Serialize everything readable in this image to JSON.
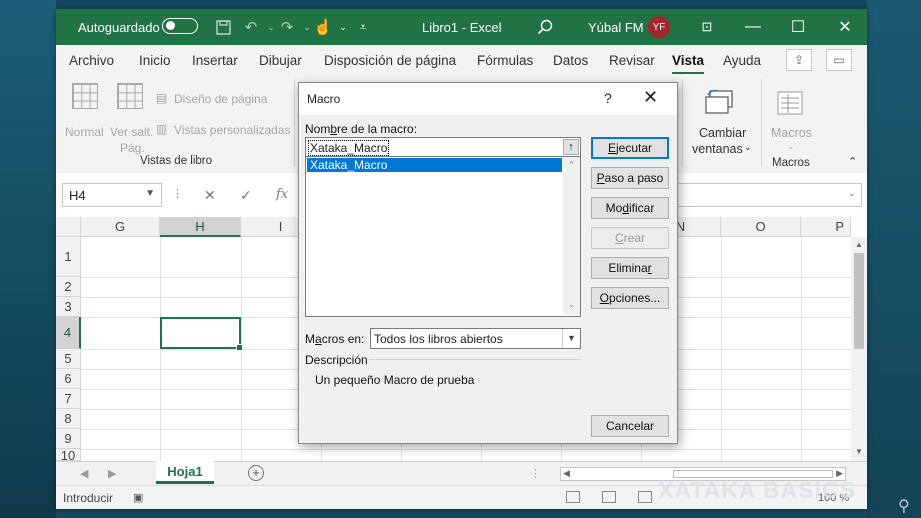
{
  "titlebar": {
    "autosave_label": "Autoguardado",
    "doc_title": "Libro1 - Excel",
    "user_name": "Yúbal FM",
    "user_initials": "YF",
    "accent": "#217346"
  },
  "menu": {
    "tabs": [
      "Archivo",
      "Inicio",
      "Insertar",
      "Dibujar",
      "Disposición de página",
      "Fórmulas",
      "Datos",
      "Revisar",
      "Vista",
      "Ayuda"
    ],
    "active_tab": "Vista"
  },
  "ribbon": {
    "normal": "Normal",
    "page_break_1": "Ver salt.",
    "page_break_2": "Pág.",
    "page_layout": "Diseño de página",
    "custom_views": "Vistas personalizadas",
    "group_views": "Vistas de libro",
    "switch_windows_1": "Cambiar",
    "switch_windows_2": "ventanas",
    "macros": "Macros",
    "group_macros": "Macros"
  },
  "formula_bar": {
    "name_box": "H4",
    "fx": "fx"
  },
  "sheet": {
    "columns": [
      "G",
      "H",
      "I",
      "N",
      "O",
      "P"
    ],
    "selected_column": "H",
    "rows": [
      "1",
      "2",
      "3",
      "4",
      "5",
      "6",
      "7",
      "8",
      "9",
      "10"
    ],
    "selected_row": "4",
    "tab_name": "Hoja1"
  },
  "status": {
    "mode": "Introducir",
    "zoom": "100 %"
  },
  "watermark": "XATAKA BASICS",
  "dialog": {
    "title": "Macro",
    "help": "?",
    "close": "✕",
    "name_label_pre": "Nom",
    "name_label_u": "b",
    "name_label_post": "re de la macro:",
    "macro_name_value": "Xataka_Macro",
    "macro_list": [
      "Xataka_Macro"
    ],
    "buttons": {
      "run": {
        "pre": "",
        "u": "E",
        "post": "jecutar"
      },
      "step": {
        "pre": "",
        "u": "P",
        "post": "aso a paso"
      },
      "modify": {
        "pre": "Mo",
        "u": "d",
        "post": "ificar"
      },
      "create": {
        "pre": "",
        "u": "C",
        "post": "rear"
      },
      "delete": {
        "pre": "Elimina",
        "u": "r",
        "post": ""
      },
      "options": {
        "pre": "",
        "u": "O",
        "post": "pciones..."
      },
      "cancel": "Cancelar"
    },
    "macros_in_pre": "M",
    "macros_in_u": "a",
    "macros_in_post": "cros en:",
    "macros_in_value": "Todos los libros abiertos",
    "description_label": "Descripción",
    "description_text": "Un pequeño Macro de prueba"
  }
}
